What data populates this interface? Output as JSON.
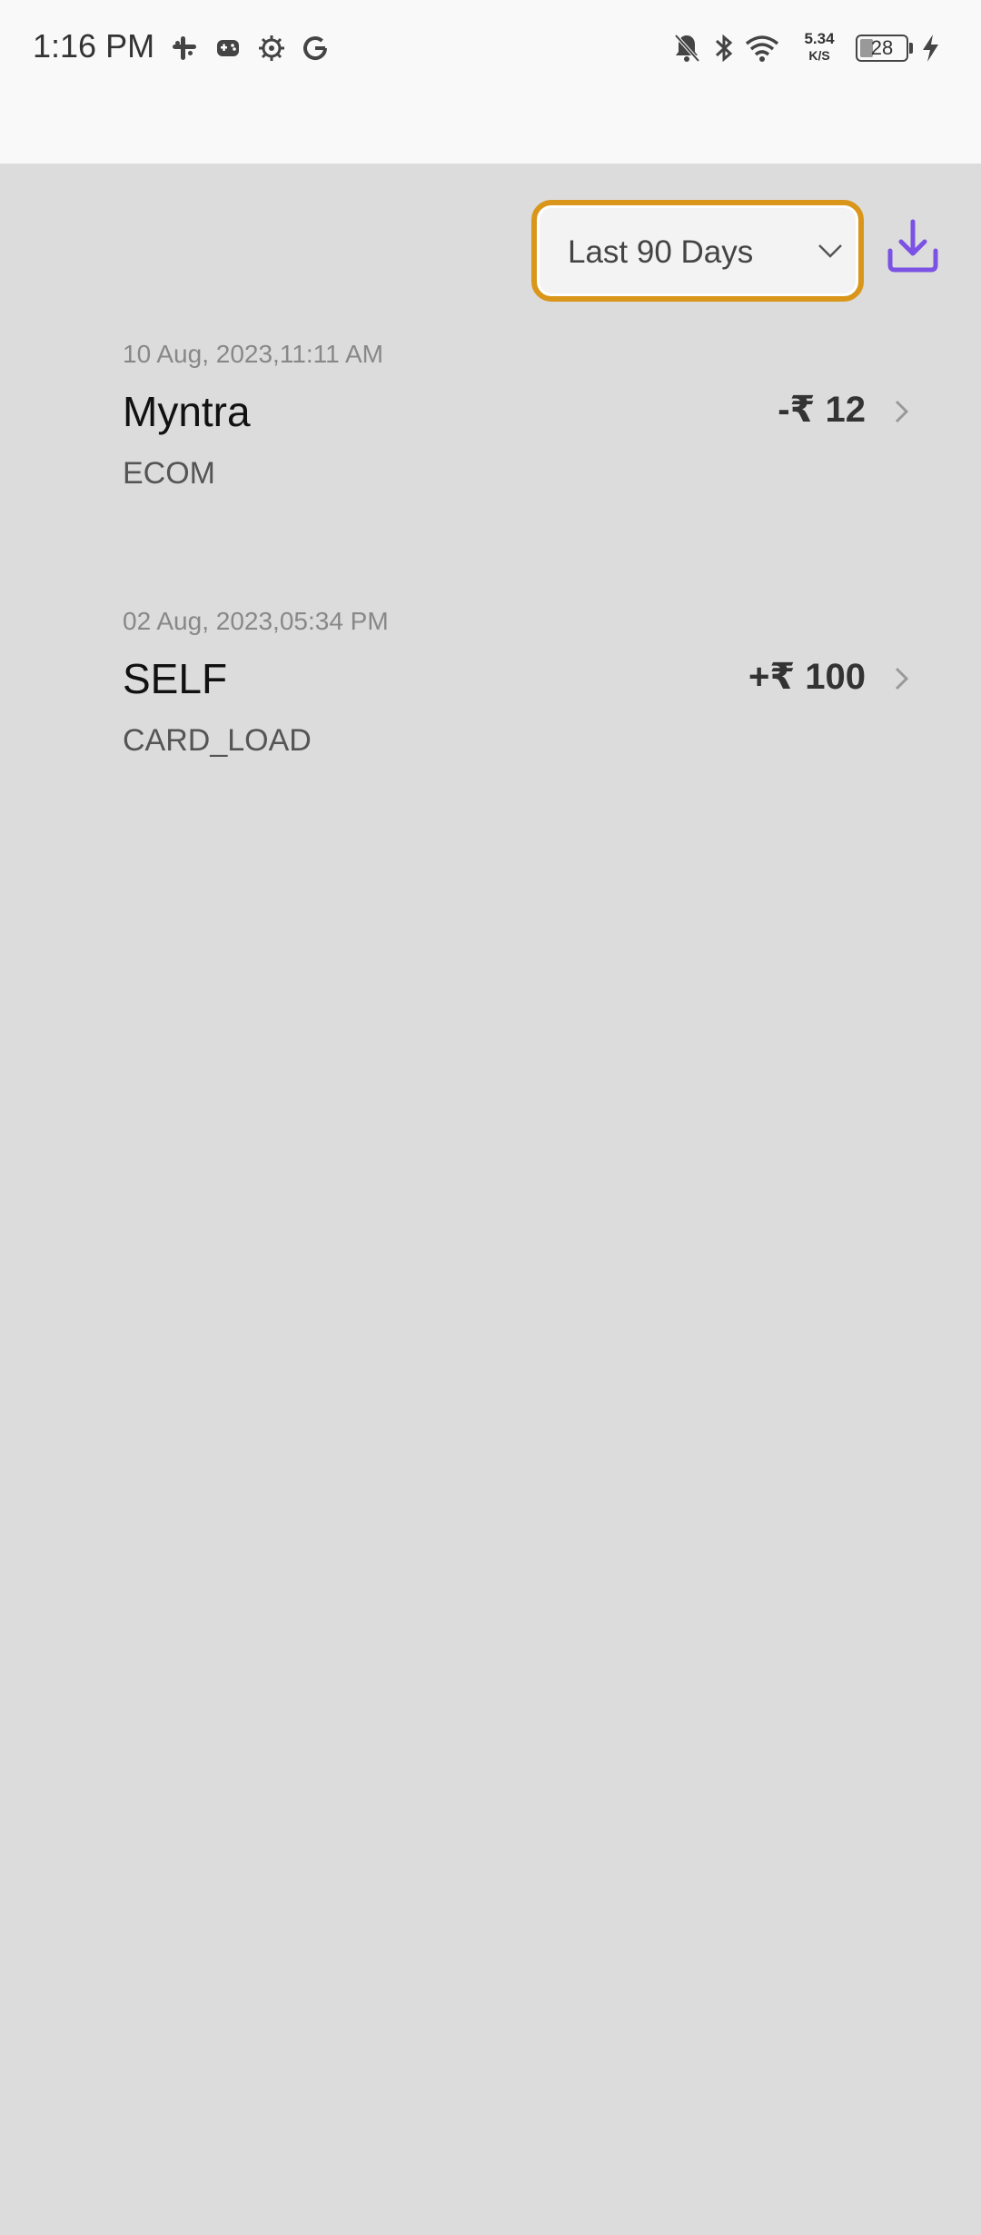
{
  "status_bar": {
    "time": "1:16 PM",
    "left_icons": [
      "slack-icon",
      "game-controller-icon",
      "settings-gear-icon",
      "google-icon"
    ],
    "right_icons": [
      "notifications-off-icon",
      "bluetooth-icon",
      "wifi-icon",
      "battery-icon",
      "charging-icon"
    ],
    "network_speed_value": "5.34",
    "network_speed_unit": "K/S",
    "battery_level": "28"
  },
  "filter": {
    "selected": "Last 90 Days",
    "accent_color": "#d9961a"
  },
  "download": {
    "icon": "download-icon",
    "color": "#7b52e3"
  },
  "transactions": [
    {
      "date": "10 Aug, 2023,11:11 AM",
      "name": "Myntra",
      "type": "ECOM",
      "amount": "-₹ 12"
    },
    {
      "date": "02 Aug, 2023,05:34 PM",
      "name": "SELF",
      "type": "CARD_LOAD",
      "amount": "+₹ 100"
    }
  ]
}
